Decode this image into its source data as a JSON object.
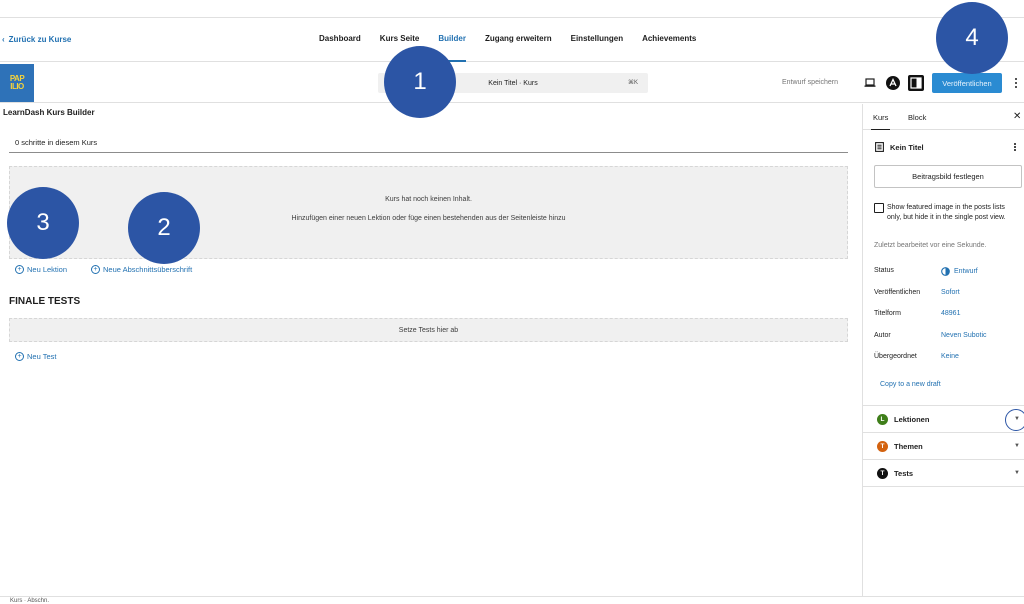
{
  "nav": {
    "back_label": "Zurück zu Kurse",
    "tabs": [
      {
        "label": "Dashboard"
      },
      {
        "label": "Kurs Seite"
      },
      {
        "label": "Builder",
        "active": true
      },
      {
        "label": "Zugang erweitern"
      },
      {
        "label": "Einstellungen"
      },
      {
        "label": "Achievements"
      }
    ]
  },
  "editor_bar": {
    "logo_line1": "PAP",
    "logo_line2": "ILIO",
    "command": "Kein Titel · Kurs",
    "command_shortcut": "⌘K",
    "save_draft": "Entwurf speichern",
    "publish": "Veröffentlichen"
  },
  "builder": {
    "title": "LearnDash Kurs Builder",
    "steps": "0 schritte in diesem Kurs",
    "empty_title": "Kurs hat noch keinen Inhalt.",
    "empty_hint": "Hinzufügen einer neuen Lektion oder füge einen bestehenden aus der Seitenleiste hinzu",
    "new_lesson": "Neu Lektion",
    "new_section": "Neue Abschnittsüberschrift",
    "final_tests": "FINALE TESTS",
    "tests_drop": "Setze Tests hier ab",
    "new_test": "Neu Test"
  },
  "badges": [
    "1",
    "2",
    "3",
    "4"
  ],
  "sidebar": {
    "tab_course": "Kurs",
    "tab_block": "Block",
    "post_title": "Kein Titel",
    "featured_button": "Beitragsbild festlegen",
    "featured_checkbox": "Show featured image in the posts lists only, but hide it in the single post view.",
    "last_edited": "Zuletzt bearbeitet vor eine Sekunde.",
    "meta": [
      {
        "label": "Status",
        "value": "Entwurf"
      },
      {
        "label": "Veröffentlichen",
        "value": "Sofort"
      },
      {
        "label": "Titelform",
        "value": "48961"
      },
      {
        "label": "Autor",
        "value": "Neven Subotic"
      },
      {
        "label": "Übergeordnet",
        "value": "Keine"
      }
    ],
    "copy_draft": "Copy to a new draft",
    "panels": [
      {
        "label": "Lektionen",
        "letter": "L",
        "color": "#3f7e1a"
      },
      {
        "label": "Themen",
        "letter": "T",
        "color": "#d3620f"
      },
      {
        "label": "Tests",
        "letter": "T",
        "color": "#111111"
      }
    ]
  },
  "footer": "Kurs · Abschn."
}
